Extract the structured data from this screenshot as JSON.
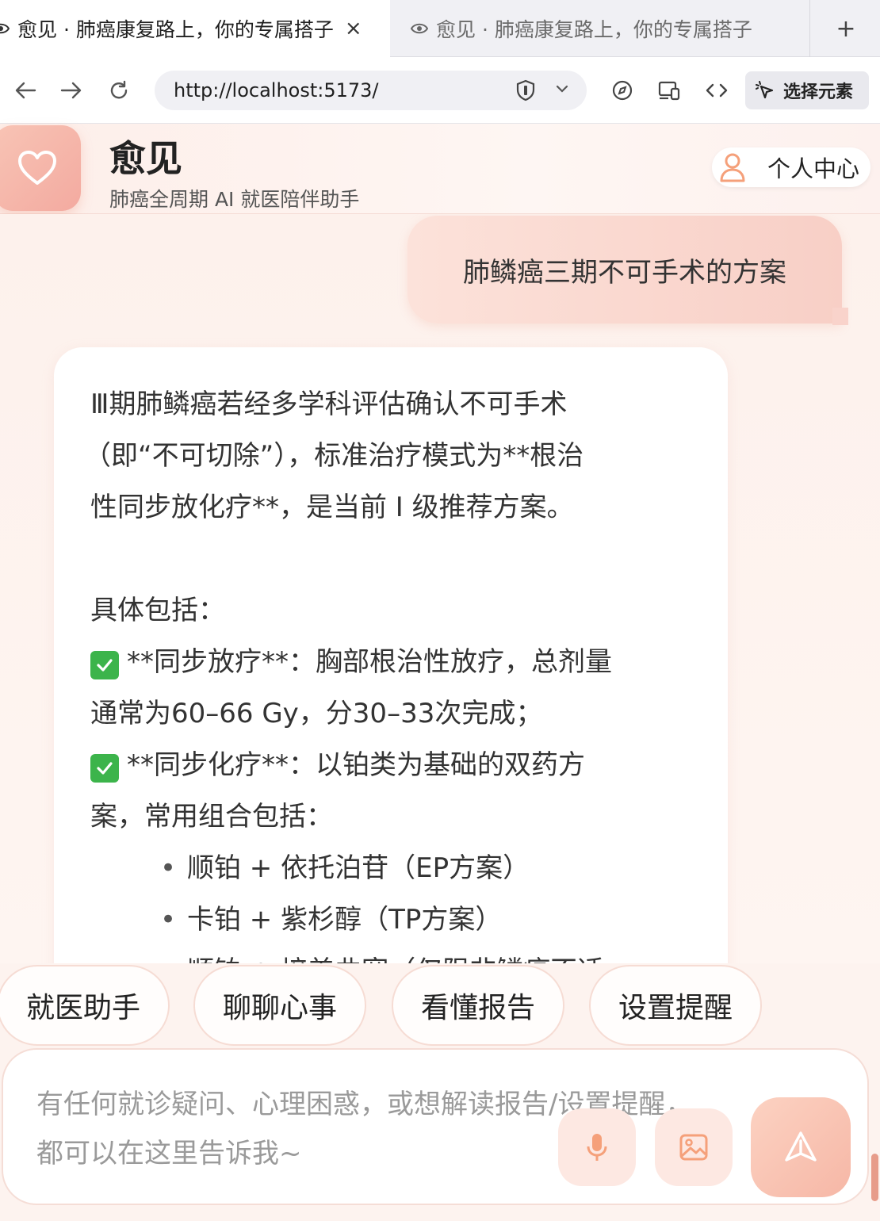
{
  "browser": {
    "tabs": [
      {
        "title": "愈见 · 肺癌康复路上，你的专属搭子",
        "active": true,
        "close": "×"
      },
      {
        "title": "愈见 · 肺癌康复路上，你的专属搭子",
        "active": false
      }
    ],
    "new_tab": "+",
    "url": "http://localhost:5173/",
    "select_element_label": "选择元素"
  },
  "header": {
    "title": "愈见",
    "subtitle": "肺癌全周期 AI 就医陪伴助手",
    "profile_label": "个人中心",
    "accent_color": "#f3aaa0"
  },
  "chat": {
    "user_message": "肺鳞癌三期不可手术的方案",
    "ai_lines": [
      "Ⅲ期肺鳞癌若经多学科评估确认不可手术",
      "（即“不可切除”），标准治疗模式为**根治",
      "性同步放化疗**，是当前 Ⅰ 级推荐方案。",
      "",
      "具体包括：",
      "**同步放疗**：胸部根治性放疗，总剂量",
      "通常为60–66 Gy，分30–33次完成；",
      "**同步化疗**：以铂类为基础的双药方",
      "案，常用组合包括：",
      "顺铂 + 依托泊苷（EP方案）",
      "卡铂 + 紫杉醇（TP方案）",
      "顺铂 + 培美曲塞（仅限非鳞癌不适"
    ],
    "bullet": "•"
  },
  "quick_actions": [
    "就医助手",
    "聊聊心事",
    "看懂报告",
    "设置提醒"
  ],
  "composer": {
    "placeholder": "有任何就诊疑问、心理困惑，或想解读报告/设置提醒，都可以在这里告诉我~"
  }
}
